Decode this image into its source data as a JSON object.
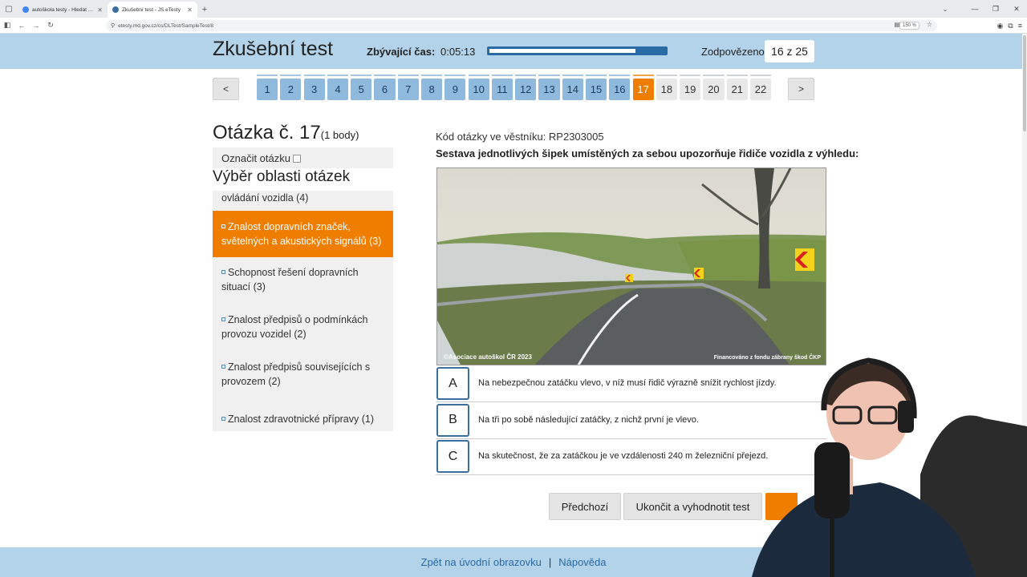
{
  "browser": {
    "tabs": [
      {
        "title": "autoškola testy - Hledat Goog",
        "active": false,
        "favicon_color": "#4285f4"
      },
      {
        "title": "Zkušební test - JS eTesty",
        "active": true,
        "favicon_color": "#3b6f9e"
      }
    ],
    "url": "etesty.md.gov.cz/cs/DLTest/SampleTest/8",
    "zoom": "150 %"
  },
  "header": {
    "title": "Zkušební test",
    "time_label": "Zbývající čas:",
    "time_value": "0:05:13",
    "time_fraction_remaining": 0.83,
    "answered_label": "Zodpovězeno",
    "answered_value": "16 z 25"
  },
  "question_nav": {
    "prev_label": "<",
    "next_label": ">",
    "items": [
      {
        "n": "1",
        "state": "answered"
      },
      {
        "n": "2",
        "state": "answered"
      },
      {
        "n": "3",
        "state": "answered"
      },
      {
        "n": "4",
        "state": "answered"
      },
      {
        "n": "5",
        "state": "answered"
      },
      {
        "n": "6",
        "state": "answered"
      },
      {
        "n": "7",
        "state": "answered"
      },
      {
        "n": "8",
        "state": "answered"
      },
      {
        "n": "9",
        "state": "answered"
      },
      {
        "n": "10",
        "state": "answered"
      },
      {
        "n": "11",
        "state": "answered"
      },
      {
        "n": "12",
        "state": "answered"
      },
      {
        "n": "13",
        "state": "answered"
      },
      {
        "n": "14",
        "state": "answered"
      },
      {
        "n": "15",
        "state": "answered"
      },
      {
        "n": "16",
        "state": "answered"
      },
      {
        "n": "17",
        "state": "current"
      },
      {
        "n": "18",
        "state": "unanswered"
      },
      {
        "n": "19",
        "state": "unanswered"
      },
      {
        "n": "20",
        "state": "unanswered"
      },
      {
        "n": "21",
        "state": "unanswered"
      },
      {
        "n": "22",
        "state": "unanswered"
      }
    ]
  },
  "question": {
    "title": "Otázka č. 17",
    "points": "(1 body)",
    "mark_label": "Označit otázku",
    "code": "Kód otázky ve věstníku: RP2303005",
    "text": "Sestava jednotlivých šipek umístěných za sebou upozorňuje řidiče vozidla z výhledu:",
    "photo_caption_left": "©Asociace autoškol ČR 2023",
    "photo_caption_right": "Financováno z fondu zábrany škod ČKP",
    "answers": [
      {
        "letter": "A",
        "text": "Na nebezpečnou zatáčku vlevo, v níž musí řidič výrazně snížit rychlost jízdy."
      },
      {
        "letter": "B",
        "text": "Na tři po sobě následující zatáčky, z nichž první je vlevo."
      },
      {
        "letter": "C",
        "text": "Na skutečnost, že za zatáčkou je ve vzdálenosti 240 m železniční přejezd."
      }
    ]
  },
  "areas": {
    "title": "Výběr oblasti otázek",
    "items": [
      {
        "label_lines": [
          "ovládání vozidla (4)"
        ],
        "selected": false,
        "bullet": false
      },
      {
        "label_lines": [
          "Znalost dopravních značek,",
          "světelných a akustických signálů (3)"
        ],
        "selected": true,
        "bullet": true
      },
      {
        "label_lines": [
          "Schopnost řešení dopravních",
          "situací (3)"
        ],
        "selected": false,
        "bullet": true
      },
      {
        "label_lines": [
          "Znalost předpisů o podmínkách",
          "provozu vozidel (2)"
        ],
        "selected": false,
        "bullet": true
      },
      {
        "label_lines": [
          "Znalost předpisů souvisejících s",
          "provozem (2)"
        ],
        "selected": false,
        "bullet": true
      },
      {
        "label_lines": [
          "Znalost zdravotnické přípravy (1)"
        ],
        "selected": false,
        "bullet": true
      }
    ]
  },
  "actions": {
    "prev_label": "Předchozí",
    "finish_label": "Ukončit a vyhodnotit test"
  },
  "footer": {
    "home_link": "Zpět na úvodní obrazovku",
    "separator": "|",
    "help_link": "Nápověda"
  },
  "colors": {
    "header_bg": "#b3d3ea",
    "accent_orange": "#ef7d00",
    "answered_blue": "#8fb9dd",
    "link_blue": "#2a6aa5"
  }
}
